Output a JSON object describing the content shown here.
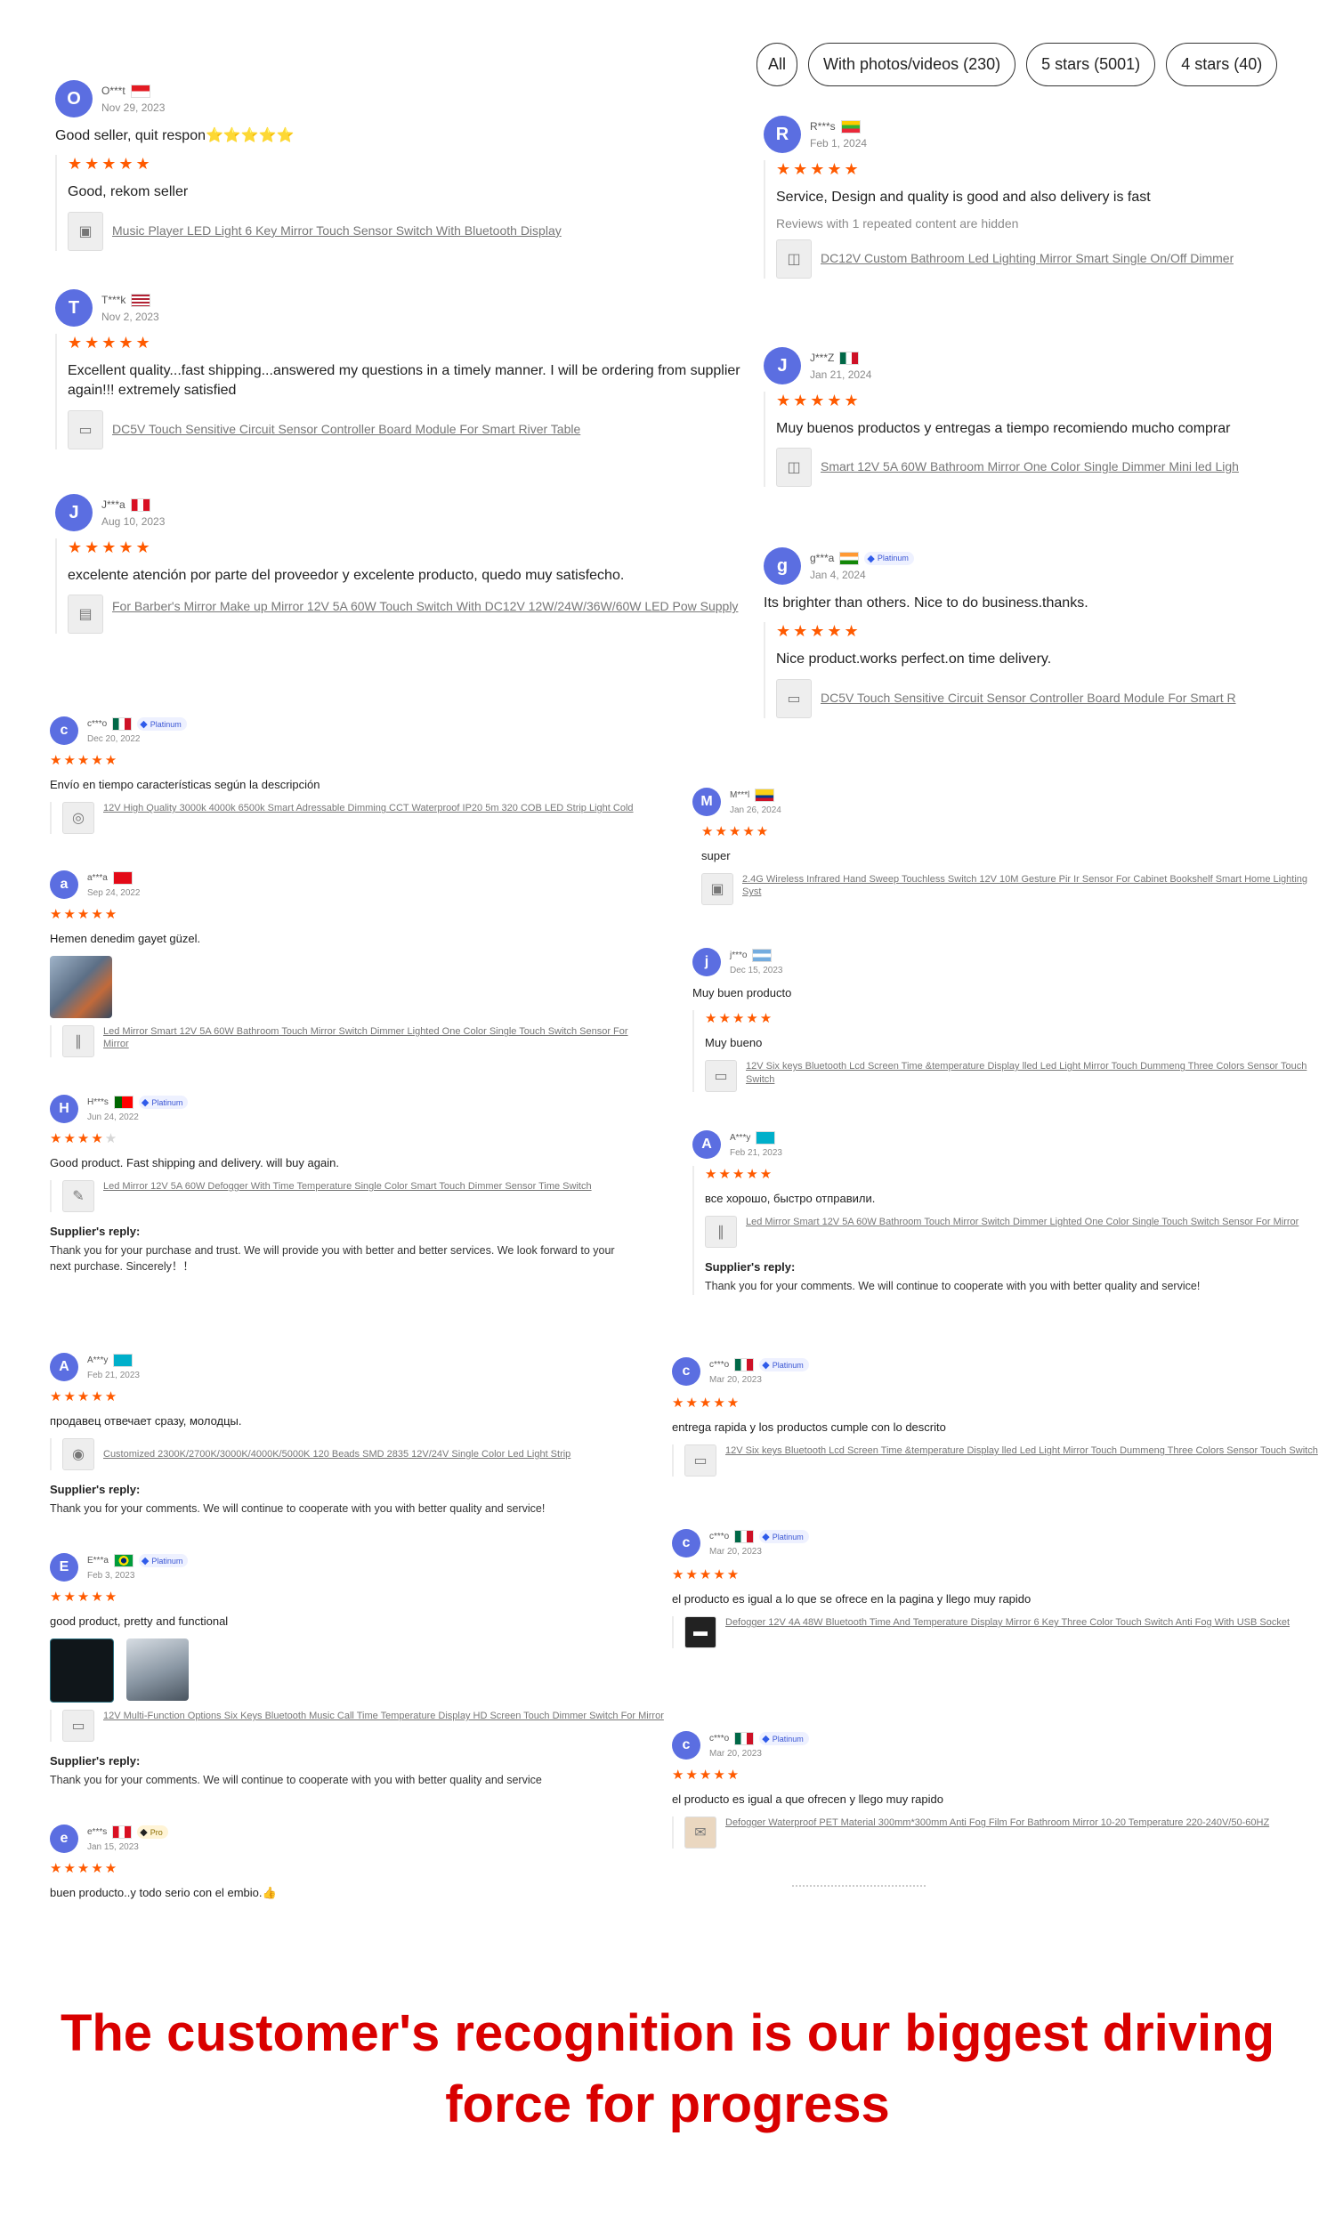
{
  "filters": [
    {
      "label": "All"
    },
    {
      "label": "With photos/videos (230)"
    },
    {
      "label": "5 stars (5001)"
    },
    {
      "label": "4 stars (40)"
    }
  ],
  "reviews": [
    {
      "initial": "O",
      "name": "O***t",
      "date": "Nov 29, 2023",
      "headline": "Good seller, quit respon⭐⭐⭐⭐⭐",
      "stars": "★★★★★",
      "text": "Good, rekom seller",
      "product": "Music Player LED Light 6 Key Mirror Touch Sensor Switch With Bluetooth Display"
    },
    {
      "initial": "T",
      "name": "T***k",
      "date": "Nov 2, 2023",
      "stars": "★★★★★",
      "text": "Excellent quality...fast shipping...answered my questions in a timely manner. I will be ordering from supplier again!!! extremely satisfied",
      "product": "DC5V Touch Sensitive Circuit Sensor Controller Board Module For Smart River Table"
    },
    {
      "initial": "J",
      "name": "J***a",
      "date": "Aug 10, 2023",
      "stars": "★★★★★",
      "text": "excelente atención por parte del proveedor y excelente producto, quedo muy satisfecho.",
      "product": "For Barber's Mirror Make up Mirror 12V 5A 60W Touch Switch With DC12V 12W/24W/36W/60W LED Pow Supply"
    },
    {
      "initial": "R",
      "name": "R***s",
      "date": "Feb 1, 2024",
      "stars": "★★★★★",
      "text": "Service, Design and quality is good and also delivery is fast",
      "sub": "Reviews with 1 repeated content are hidden",
      "product": "DC12V Custom Bathroom Led Lighting Mirror Smart Single On/Off Dimmer"
    },
    {
      "initial": "J",
      "name": "J***Z",
      "date": "Jan 21, 2024",
      "stars": "★★★★★",
      "text": "Muy buenos productos y entregas a tiempo recomiendo mucho comprar",
      "product": "Smart 12V 5A 60W Bathroom Mirror One Color Single Dimmer Mini led Ligh"
    },
    {
      "initial": "g",
      "name": "g***a",
      "badge": "Platinum",
      "date": "Jan 4, 2024",
      "headline": "Its brighter than others. Nice to do business.thanks.",
      "stars": "★★★★★",
      "text": "Nice product.works perfect.on time delivery.",
      "product": "DC5V Touch Sensitive Circuit Sensor Controller Board Module For Smart R"
    },
    {
      "initial": "c",
      "name": "c***o",
      "badge": "Platinum",
      "date": "Dec 20, 2022",
      "stars": "★★★★★",
      "text": "Envío en tiempo características según la descripción",
      "product": "12V High Quality 3000k 4000k 6500k Smart Adressable Dimming CCT Waterproof IP20 5m 320 COB LED Strip Light Cold"
    },
    {
      "initial": "a",
      "name": "a***a",
      "date": "Sep 24, 2022",
      "stars": "★★★★★",
      "text": "Hemen denedim gayet güzel.",
      "product": "Led Mirror Smart 12V 5A 60W Bathroom Touch Mirror Switch Dimmer Lighted One Color Single Touch Switch Sensor For Mirror"
    },
    {
      "initial": "H",
      "name": "H***s",
      "badge": "Platinum",
      "date": "Jun 24, 2022",
      "stars": "★★★★",
      "stars_off": "★",
      "text": "Good product. Fast shipping and delivery. will buy again.",
      "product": "Led Mirror 12V 5A 60W Defogger With Time Temperature Single Color Smart Touch Dimmer Sensor Time Switch",
      "reply_label": "Supplier's reply:",
      "reply": "Thank you for your purchase and trust. We will provide you with better and better services. We look forward to your next purchase. Sincerely！！"
    },
    {
      "initial": "M",
      "name": "M***l",
      "date": "Jan 26, 2024",
      "stars": "★★★★★",
      "text": "super",
      "product": "2.4G Wireless Infrared Hand Sweep Touchless Switch 12V 10M Gesture Pir Ir Sensor For Cabinet Bookshelf Smart Home Lighting Syst"
    },
    {
      "initial": "j",
      "name": "j***o",
      "date": "Dec 15, 2023",
      "headline": "Muy buen producto",
      "stars": "★★★★★",
      "text": "Muy bueno",
      "product": "12V Six keys Bluetooth Lcd Screen Time &temperature Display lled Led Light Mirror Touch Dummeng Three Colors Sensor Touch Switch"
    },
    {
      "initial": "A",
      "name": "A***y",
      "date": "Feb 21, 2023",
      "stars": "★★★★★",
      "text": "все хорошо, быстро отправили.",
      "product": "Led Mirror Smart 12V 5A 60W Bathroom Touch Mirror Switch Dimmer Lighted One Color Single Touch Switch Sensor For Mirror",
      "reply_label": "Supplier's reply:",
      "reply": "Thank you for your comments. We will continue to cooperate with you with better quality and service!"
    },
    {
      "initial": "A",
      "name": "A***y",
      "date": "Feb 21, 2023",
      "stars": "★★★★★",
      "text": "продавец отвечает сразу, молодцы.",
      "product": "Customized 2300K/2700K/3000K/4000K/5000K 120 Beads SMD 2835 12V/24V Single Color Led Light Strip",
      "reply_label": "Supplier's reply:",
      "reply": "Thank you for your comments. We will continue to cooperate with you with better quality and service!"
    },
    {
      "initial": "E",
      "name": "E***a",
      "badge": "Platinum",
      "date": "Feb 3, 2023",
      "stars": "★★★★★",
      "text": "good product, pretty and functional",
      "product": "12V Multi-Function Options Six Keys Bluetooth Music Call Time Temperature Display HD Screen Touch Dimmer Switch For Mirror",
      "reply_label": "Supplier's reply:",
      "reply": "Thank you for your comments. We will continue to cooperate with you with better quality and service"
    },
    {
      "initial": "e",
      "name": "e***s",
      "badge": "Pro",
      "date": "Jan 15, 2023",
      "stars": "★★★★★",
      "text": "buen producto..y todo serio con el embio.👍"
    },
    {
      "initial": "c",
      "name": "c***o",
      "badge": "Platinum",
      "date": "Mar 20, 2023",
      "stars": "★★★★★",
      "text": "entrega rapida y los productos cumple con lo descrito",
      "product": "12V Six keys Bluetooth Lcd Screen Time &temperature Display lled Led Light Mirror Touch Dummeng Three Colors Sensor Touch Switch"
    },
    {
      "initial": "c",
      "name": "c***o",
      "badge": "Platinum",
      "date": "Mar 20, 2023",
      "stars": "★★★★★",
      "text": "el producto es igual a lo que se ofrece en la pagina y llego muy rapido",
      "product": "Defogger 12V 4A 48W Bluetooth Time And Temperature Display Mirror 6 Key Three Color Touch Switch Anti Fog With USB Socket"
    },
    {
      "initial": "c",
      "name": "c***o",
      "badge": "Platinum",
      "date": "Mar 20, 2023",
      "stars": "★★★★★",
      "text": "el producto es igual a que ofrecen y llego muy rapido",
      "product": "Defogger Waterproof PET Material 300mm*300mm Anti Fog Film For Bathroom Mirror 10-20 Temperature 220-240V/50-60HZ"
    }
  ],
  "tagline": {
    "line1": "The customer's recognition is our biggest driving",
    "line2": "force for progress"
  },
  "colors": {
    "star": "#ff5a00",
    "avatar": "#5b6ee1",
    "tagline": "#d90000"
  }
}
